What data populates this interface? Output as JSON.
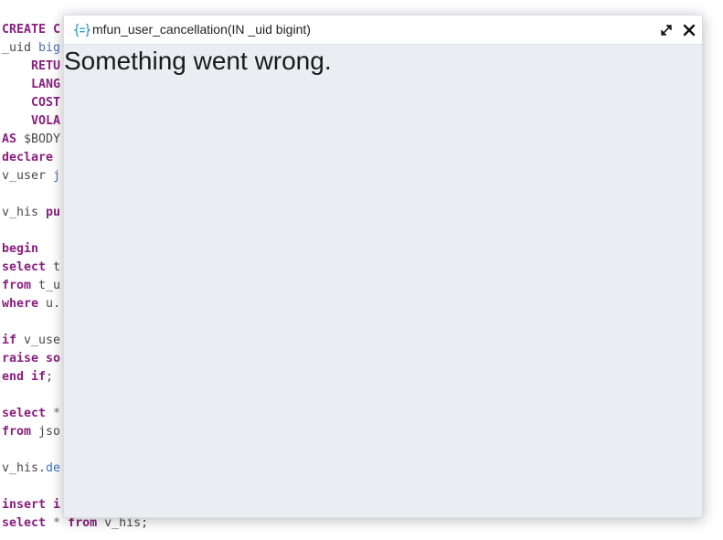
{
  "editor": {
    "lines": [
      {
        "parts": [
          {
            "t": "CREATE C",
            "c": "kw"
          }
        ]
      },
      {
        "parts": [
          {
            "t": "_uid ",
            "c": "plain"
          },
          {
            "t": "big",
            "c": "cast"
          }
        ]
      },
      {
        "parts": [
          {
            "t": "    ",
            "c": "plain"
          },
          {
            "t": "RETU",
            "c": "kw"
          }
        ]
      },
      {
        "parts": [
          {
            "t": "    ",
            "c": "plain"
          },
          {
            "t": "LANG",
            "c": "kw"
          }
        ]
      },
      {
        "parts": [
          {
            "t": "    ",
            "c": "plain"
          },
          {
            "t": "COST",
            "c": "kw"
          }
        ]
      },
      {
        "parts": [
          {
            "t": "    ",
            "c": "plain"
          },
          {
            "t": "VOLA",
            "c": "kw"
          }
        ]
      },
      {
        "parts": [
          {
            "t": "AS ",
            "c": "kw"
          },
          {
            "t": "$BODY",
            "c": "plain"
          }
        ]
      },
      {
        "parts": [
          {
            "t": "declare",
            "c": "kw"
          }
        ]
      },
      {
        "parts": [
          {
            "t": "v_user ",
            "c": "plain"
          },
          {
            "t": "j",
            "c": "cast"
          }
        ]
      },
      {
        "parts": []
      },
      {
        "parts": [
          {
            "t": "v_his ",
            "c": "plain"
          },
          {
            "t": "pu",
            "c": "kw"
          }
        ]
      },
      {
        "parts": []
      },
      {
        "parts": [
          {
            "t": "begin",
            "c": "kw"
          }
        ]
      },
      {
        "parts": [
          {
            "t": "select ",
            "c": "kw"
          },
          {
            "t": "t",
            "c": "plain"
          }
        ]
      },
      {
        "parts": [
          {
            "t": "from ",
            "c": "kw"
          },
          {
            "t": "t_u",
            "c": "plain"
          }
        ]
      },
      {
        "parts": [
          {
            "t": "where ",
            "c": "kw"
          },
          {
            "t": "u.",
            "c": "plain"
          }
        ]
      },
      {
        "parts": []
      },
      {
        "parts": [
          {
            "t": "if ",
            "c": "kw"
          },
          {
            "t": "v_use",
            "c": "plain"
          }
        ]
      },
      {
        "parts": [
          {
            "t": "raise ",
            "c": "kw"
          },
          {
            "t": "so",
            "c": "kw"
          }
        ]
      },
      {
        "parts": [
          {
            "t": "end if",
            "c": "kw"
          },
          {
            "t": ";",
            "c": "plain"
          }
        ]
      },
      {
        "parts": []
      },
      {
        "parts": [
          {
            "t": "select ",
            "c": "kw"
          },
          {
            "t": "*",
            "c": "op"
          }
        ]
      },
      {
        "parts": [
          {
            "t": "from ",
            "c": "kw"
          },
          {
            "t": "jso",
            "c": "plain"
          }
        ]
      },
      {
        "parts": []
      },
      {
        "parts": [
          {
            "t": "v_his.",
            "c": "plain"
          },
          {
            "t": "de",
            "c": "fn"
          }
        ]
      },
      {
        "parts": []
      },
      {
        "parts": [
          {
            "t": "insert ",
            "c": "kw"
          },
          {
            "t": "i",
            "c": "kw"
          }
        ]
      },
      {
        "parts": [
          {
            "t": "select ",
            "c": "kw"
          },
          {
            "t": "* ",
            "c": "op"
          },
          {
            "t": "from ",
            "c": "kw"
          },
          {
            "t": "v_his;",
            "c": "plain"
          }
        ]
      }
    ]
  },
  "modal": {
    "title": "mfun_user_cancellation(IN _uid bigint)",
    "icon": "function-braces-icon",
    "error_message": "Something went wrong.",
    "expand_icon": "expand-icon",
    "close_icon": "close-icon"
  },
  "colors": {
    "keyword": "#8a1f80",
    "plain": "#4a4a4a",
    "function": "#3f78c0",
    "modal_body": "#eaedf2",
    "icon_teal": "#2a9fb8"
  }
}
